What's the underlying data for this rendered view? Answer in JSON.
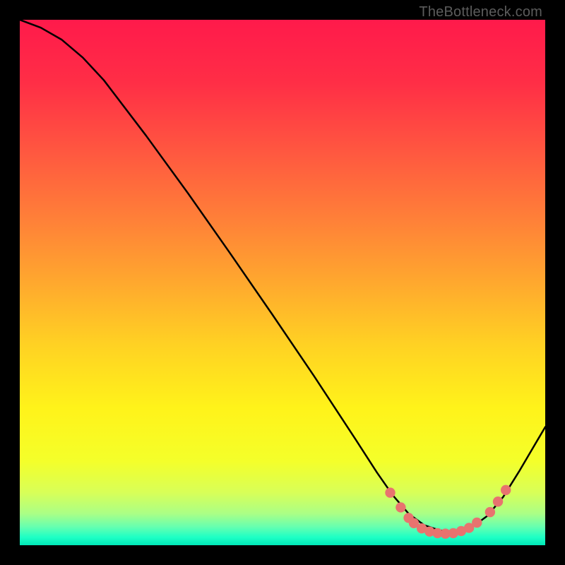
{
  "watermark": "TheBottleneck.com",
  "chart_data": {
    "type": "line",
    "title": "",
    "xlabel": "",
    "ylabel": "",
    "x_range": [
      0,
      100
    ],
    "y_range": [
      0,
      100
    ],
    "curve": [
      {
        "x": 0,
        "y": 100
      },
      {
        "x": 4,
        "y": 98.5
      },
      {
        "x": 8,
        "y": 96.2
      },
      {
        "x": 12,
        "y": 92.8
      },
      {
        "x": 16,
        "y": 88.5
      },
      {
        "x": 24,
        "y": 78.0
      },
      {
        "x": 32,
        "y": 67.0
      },
      {
        "x": 40,
        "y": 55.6
      },
      {
        "x": 48,
        "y": 44.0
      },
      {
        "x": 56,
        "y": 32.2
      },
      {
        "x": 64,
        "y": 20.0
      },
      {
        "x": 68,
        "y": 13.8
      },
      {
        "x": 71,
        "y": 9.5
      },
      {
        "x": 74,
        "y": 6.0
      },
      {
        "x": 77,
        "y": 3.8
      },
      {
        "x": 80,
        "y": 2.8
      },
      {
        "x": 83,
        "y": 2.6
      },
      {
        "x": 86,
        "y": 3.4
      },
      {
        "x": 89,
        "y": 5.6
      },
      {
        "x": 92,
        "y": 9.2
      },
      {
        "x": 95,
        "y": 14.0
      },
      {
        "x": 100,
        "y": 22.5
      }
    ],
    "markers": [
      {
        "x": 70.5,
        "y": 10.0
      },
      {
        "x": 72.5,
        "y": 7.2
      },
      {
        "x": 74.0,
        "y": 5.2
      },
      {
        "x": 75.0,
        "y": 4.2
      },
      {
        "x": 76.5,
        "y": 3.2
      },
      {
        "x": 78.0,
        "y": 2.6
      },
      {
        "x": 79.5,
        "y": 2.3
      },
      {
        "x": 81.0,
        "y": 2.2
      },
      {
        "x": 82.5,
        "y": 2.3
      },
      {
        "x": 84.0,
        "y": 2.7
      },
      {
        "x": 85.5,
        "y": 3.3
      },
      {
        "x": 87.0,
        "y": 4.3
      },
      {
        "x": 89.5,
        "y": 6.3
      },
      {
        "x": 91.0,
        "y": 8.3
      },
      {
        "x": 92.5,
        "y": 10.5
      }
    ],
    "gradient_stops": [
      {
        "offset": 0.0,
        "color": "#ff1a4b"
      },
      {
        "offset": 0.12,
        "color": "#ff2e46"
      },
      {
        "offset": 0.25,
        "color": "#ff5740"
      },
      {
        "offset": 0.38,
        "color": "#ff8038"
      },
      {
        "offset": 0.5,
        "color": "#ffa82e"
      },
      {
        "offset": 0.62,
        "color": "#ffd223"
      },
      {
        "offset": 0.74,
        "color": "#fff31a"
      },
      {
        "offset": 0.84,
        "color": "#f4ff2a"
      },
      {
        "offset": 0.9,
        "color": "#d8ff58"
      },
      {
        "offset": 0.94,
        "color": "#aaff86"
      },
      {
        "offset": 0.965,
        "color": "#66ffb0"
      },
      {
        "offset": 0.985,
        "color": "#1dffc5"
      },
      {
        "offset": 1.0,
        "color": "#00e8b8"
      }
    ]
  }
}
